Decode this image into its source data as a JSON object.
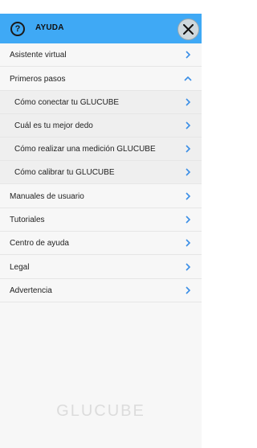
{
  "header": {
    "title": "AYUDA",
    "help_icon": "question-circle-icon",
    "close_icon": "close-icon"
  },
  "menu": {
    "items": [
      {
        "label": "Asistente virtual"
      },
      {
        "label": "Primeros pasos",
        "expanded": true,
        "children": [
          {
            "label": "Cómo conectar tu GLUCUBE"
          },
          {
            "label": "Cuál es tu mejor dedo"
          },
          {
            "label": "Cómo realizar una medición GLUCUBE"
          },
          {
            "label": "Cómo calibrar tu GLUCUBE"
          }
        ]
      },
      {
        "label": "Manuales de usuario"
      },
      {
        "label": "Tutoriales"
      },
      {
        "label": "Centro de ayuda"
      },
      {
        "label": "Legal"
      },
      {
        "label": "Advertencia"
      }
    ]
  },
  "brand": {
    "logo_text": "GLUCUBE"
  },
  "colors": {
    "header_bg": "#3fa9f5",
    "chevron": "#3a8ee6"
  }
}
